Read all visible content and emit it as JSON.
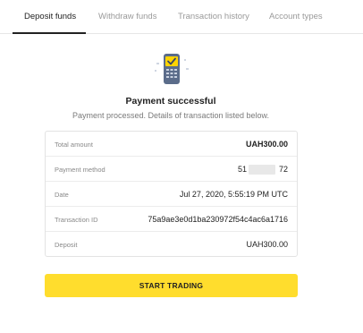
{
  "tabs": [
    {
      "label": "Deposit funds",
      "active": true
    },
    {
      "label": "Withdraw funds",
      "active": false
    },
    {
      "label": "Transaction history",
      "active": false
    },
    {
      "label": "Account types",
      "active": false
    }
  ],
  "status": {
    "icon": "card-terminal-check-icon",
    "title": "Payment successful",
    "subtitle": "Payment processed. Details of transaction listed below."
  },
  "details": {
    "total_amount": {
      "label": "Total amount",
      "value": "UAH300.00"
    },
    "payment_method": {
      "label": "Payment method",
      "value_prefix": "51",
      "value_suffix": "72"
    },
    "date": {
      "label": "Date",
      "value": "Jul 27, 2020, 5:55:19 PM UTC"
    },
    "transaction_id": {
      "label": "Transaction ID",
      "value": "75a9ae3e0d1ba230972f54c4ac6a1716"
    },
    "deposit": {
      "label": "Deposit",
      "value": "UAH300.00"
    }
  },
  "actions": {
    "start_trading_label": "START TRADING"
  },
  "colors": {
    "accent": "#ffdd2d",
    "terminal": "#5b6c8a",
    "check": "#ffd400"
  }
}
